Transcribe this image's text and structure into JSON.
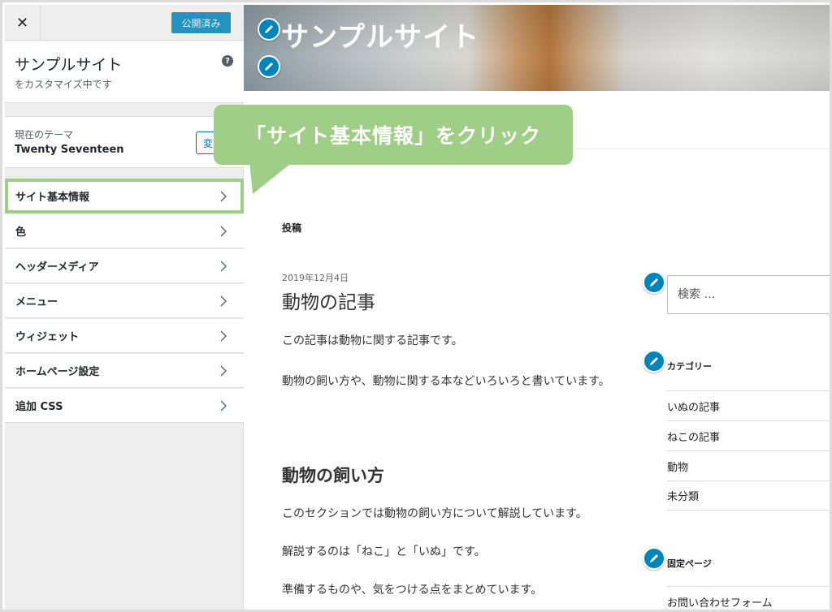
{
  "sidebar": {
    "close_icon": "close-icon",
    "publish_label": "公開済み",
    "site_title": "サンプルサイト",
    "site_subtitle": "をカスタマイズ中です",
    "help_glyph": "?",
    "theme_label": "現在のテーマ",
    "theme_name": "Twenty Seventeen",
    "change_label": "変",
    "items": [
      {
        "label": "サイト基本情報"
      },
      {
        "label": "色"
      },
      {
        "label": "ヘッダーメディア"
      },
      {
        "label": "メニュー"
      },
      {
        "label": "ウィジェット"
      },
      {
        "label": "ホームページ設定"
      },
      {
        "label": "追加 CSS"
      }
    ]
  },
  "preview": {
    "header_title": "サンプルサイト",
    "posts_label": "投稿",
    "post": {
      "date": "2019年12月4日",
      "title": "動物の記事",
      "p1": "この記事は動物に関する記事です。",
      "p2": "動物の飼い方や、動物に関する本などいろいろと書いています。",
      "section_heading": "動物の飼い方",
      "p3": "このセクションでは動物の飼い方について解説しています。",
      "p4": "解説するのは「ねこ」と「いぬ」です。",
      "p5": "準備するものや、気をつける点をまとめています。"
    },
    "search_placeholder": "検索 …",
    "categories_title": "カテゴリー",
    "categories": [
      "いぬの記事",
      "ねこの記事",
      "動物",
      "未分類"
    ],
    "pages_title": "固定ページ",
    "pages": [
      "お問い合わせフォーム"
    ]
  },
  "callout": {
    "text": "「サイト基本情報」をクリック",
    "color": "#9fce86"
  },
  "colors": {
    "accent": "#0085ba",
    "highlight": "#9fce86"
  }
}
